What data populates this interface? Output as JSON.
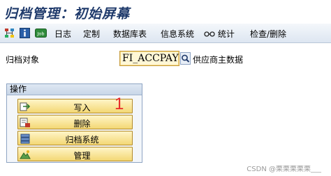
{
  "window": {
    "title": "归档管理：初始屏幕"
  },
  "toolbar": {
    "items": [
      {
        "icon": "hierarchy-icon"
      },
      {
        "icon": "info-icon"
      },
      {
        "icon": "job-icon",
        "text": "Job"
      },
      {
        "label": "日志"
      },
      {
        "label": "定制"
      },
      {
        "label": "数据库表"
      },
      {
        "label": "信息系统"
      },
      {
        "label": "统计",
        "icon": "glasses-icon",
        "prefix": "🕶"
      },
      {
        "label": "检查/删除"
      }
    ]
  },
  "form": {
    "archive_object_label": "归档对象",
    "archive_object_value": "FI_ACCPAYB",
    "archive_object_desc": "供应商主数据"
  },
  "group": {
    "title": "操作",
    "buttons": [
      {
        "label": "写入",
        "icon": "write-icon"
      },
      {
        "label": "删除",
        "icon": "delete-icon"
      },
      {
        "label": "归档系统",
        "icon": "archive-system-icon"
      },
      {
        "label": "管理",
        "icon": "manage-icon"
      }
    ]
  },
  "annotation": "1",
  "watermark": "CSDN @栗栗栗栗栗___",
  "colors": {
    "title": "#1f3a6b",
    "button_fill": "#f3d774",
    "button_border": "#b48a28",
    "annotation": "#e8292a",
    "input_bg": "#fff7d6"
  }
}
